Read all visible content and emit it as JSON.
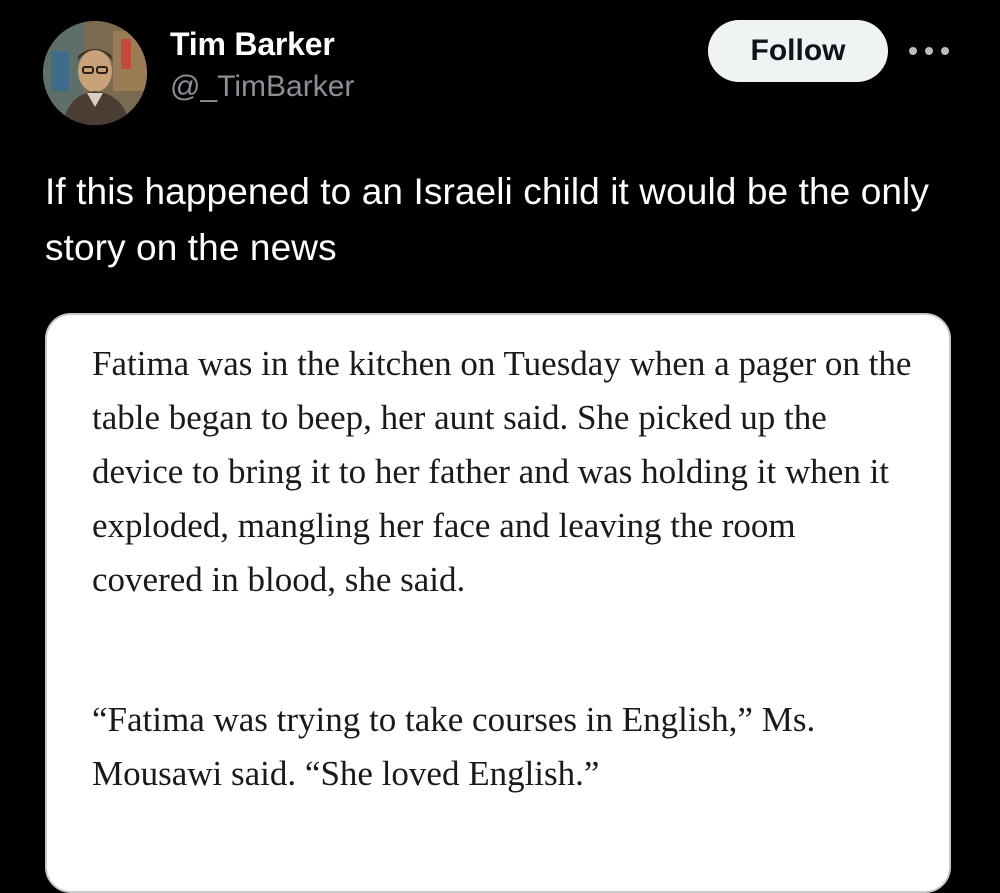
{
  "post": {
    "author": {
      "display_name": "Tim Barker",
      "handle": "@_TimBarker",
      "avatar_icon": "painted-portrait-avatar"
    },
    "follow_label": "Follow",
    "more_icon": "more-horizontal-icon",
    "text": "If this happened to an Israeli child it would be the only story on the news"
  },
  "quote_card": {
    "paragraphs": [
      "Fatima was in the kitchen on Tuesday when a pager on the table began to beep, her aunt said. She picked up the device to bring it to her father and was holding it when it exploded, mangling her face and leaving the room covered in blood, she said.",
      "“Fatima was trying to take courses in English,” Ms. Mousawi said. “She loved English.”"
    ]
  },
  "colors": {
    "background": "#000000",
    "text_primary": "#ffffff",
    "text_secondary": "#8b9096",
    "follow_button_bg": "#eff3f4",
    "card_bg": "#ffffff"
  }
}
